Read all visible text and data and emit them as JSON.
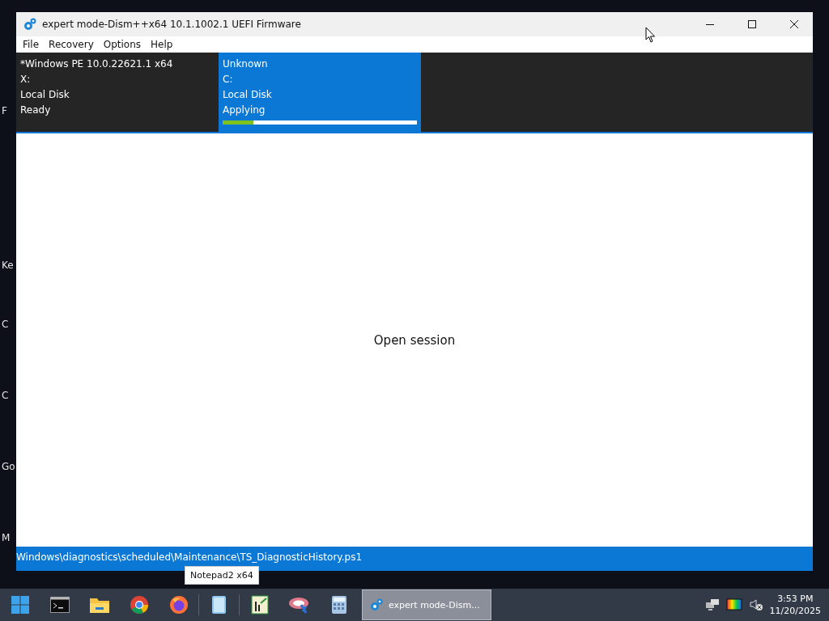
{
  "desktop": {
    "labels": [
      "F",
      "Ke",
      "C",
      "C",
      "Go",
      "M"
    ]
  },
  "window": {
    "title": "expert mode-Dism++x64 10.1.1002.1 UEFI Firmware"
  },
  "menu": [
    "File",
    "Recovery",
    "Options",
    "Help"
  ],
  "sessions": [
    {
      "selected": false,
      "lines": [
        "*Windows PE 10.0.22621.1 x64",
        "X:",
        "Local Disk",
        "Ready"
      ]
    },
    {
      "selected": true,
      "lines": [
        "Unknown",
        "C:",
        "Local Disk",
        "Applying"
      ],
      "level": 0.16
    }
  ],
  "content": {
    "message": "Open session"
  },
  "status_bar": "Windows\\diagnostics\\scheduled\\Maintenance\\TS_DiagnosticHistory.ps1",
  "tooltip": "Notepad2 x64",
  "taskbar": {
    "apps": [
      {
        "kind": "start"
      },
      {
        "kind": "terminal"
      },
      {
        "kind": "folder"
      },
      {
        "kind": "chrome"
      },
      {
        "kind": "firefox"
      },
      {
        "kind": "separator"
      },
      {
        "kind": "notepad"
      },
      {
        "kind": "separator"
      },
      {
        "kind": "chart"
      },
      {
        "kind": "tool"
      },
      {
        "kind": "calculator"
      }
    ],
    "active_task": "expert mode-Dism...",
    "time": "3:53 PM",
    "date": "11/20/2025"
  }
}
